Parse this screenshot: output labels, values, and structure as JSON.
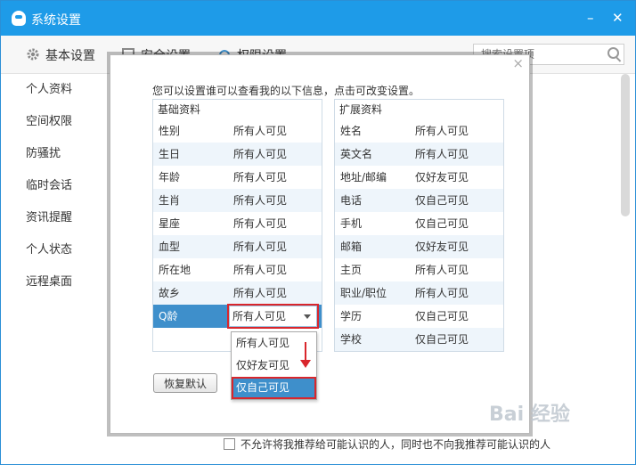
{
  "window": {
    "title": "系统设置",
    "minimize": "–",
    "close": "✕"
  },
  "topnav": {
    "basic_label": "基本设置",
    "security_label": "安全设置",
    "permission_label": "权限设置",
    "search_placeholder": "搜索设置项"
  },
  "sidebar": {
    "items": [
      {
        "label": "个人资料"
      },
      {
        "label": "空间权限"
      },
      {
        "label": "防骚扰"
      },
      {
        "label": "临时会话"
      },
      {
        "label": "资讯提醒"
      },
      {
        "label": "个人状态"
      },
      {
        "label": "远程桌面"
      }
    ]
  },
  "dialog": {
    "close": "×",
    "intro": "您可以设置谁可以查看我的以下信息，点击可改变设置。",
    "basic": {
      "header": "基础资料",
      "rows": [
        {
          "key": "性别",
          "value": "所有人可见"
        },
        {
          "key": "生日",
          "value": "所有人可见"
        },
        {
          "key": "年龄",
          "value": "所有人可见"
        },
        {
          "key": "生肖",
          "value": "所有人可见"
        },
        {
          "key": "星座",
          "value": "所有人可见"
        },
        {
          "key": "血型",
          "value": "所有人可见"
        },
        {
          "key": "所在地",
          "value": "所有人可见"
        },
        {
          "key": "故乡",
          "value": "所有人可见"
        },
        {
          "key": "Q龄",
          "value": "所有人可见"
        }
      ]
    },
    "extended": {
      "header": "扩展资料",
      "rows": [
        {
          "key": "姓名",
          "value": "所有人可见"
        },
        {
          "key": "英文名",
          "value": "所有人可见"
        },
        {
          "key": "地址/邮编",
          "value": "仅好友可见"
        },
        {
          "key": "电话",
          "value": "仅自己可见"
        },
        {
          "key": "手机",
          "value": "仅自己可见"
        },
        {
          "key": "邮箱",
          "value": "仅好友可见"
        },
        {
          "key": "主页",
          "value": "所有人可见"
        },
        {
          "key": "职业/职位",
          "value": "所有人可见"
        },
        {
          "key": "学历",
          "value": "仅自己可见"
        },
        {
          "key": "学校",
          "value": "仅自己可见"
        }
      ]
    },
    "dropdown_options": [
      "所有人可见",
      "仅好友可见",
      "仅自己可见"
    ],
    "restore_label": "恢复默认"
  },
  "footer": {
    "note": "不允许将我推荐给可能认识的人，同时也不向我推荐可能认识的人"
  },
  "watermark": "Bai 经验"
}
